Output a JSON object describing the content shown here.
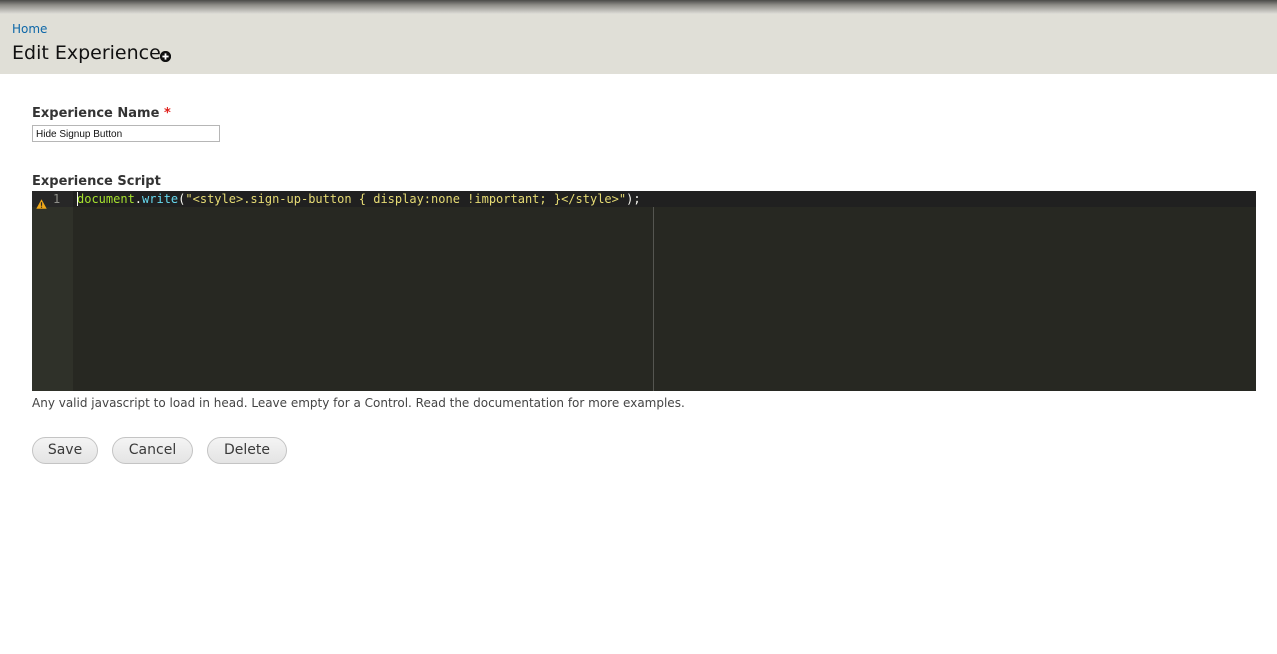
{
  "header": {
    "breadcrumb": "Home",
    "title": "Edit Experience",
    "shortcut_icon": "add-shortcut-icon"
  },
  "form": {
    "name_label": "Experience Name",
    "required_marker": "*",
    "name_value": "Hide Signup Button",
    "script_label": "Experience Script",
    "help_text": "Any valid javascript to load in head. Leave empty for a Control. Read the documentation for more examples."
  },
  "editor": {
    "line_number": "1",
    "warning_icon": "warning-icon",
    "code": {
      "object": "document",
      "dot": ".",
      "method": "write",
      "open_paren": "(",
      "string": "\"<style>.sign-up-button { display:none !important; }</style>\"",
      "close": ");"
    },
    "colors": {
      "background": "#272822",
      "gutter": "#2f3129",
      "identifier": "#a6e22e",
      "property": "#66d9ef",
      "string": "#e6db74"
    }
  },
  "buttons": {
    "save": "Save",
    "cancel": "Cancel",
    "delete": "Delete"
  },
  "colors": {
    "header_bg": "#e0dfd7",
    "link": "#0d67a8",
    "required": "#e0201b"
  }
}
